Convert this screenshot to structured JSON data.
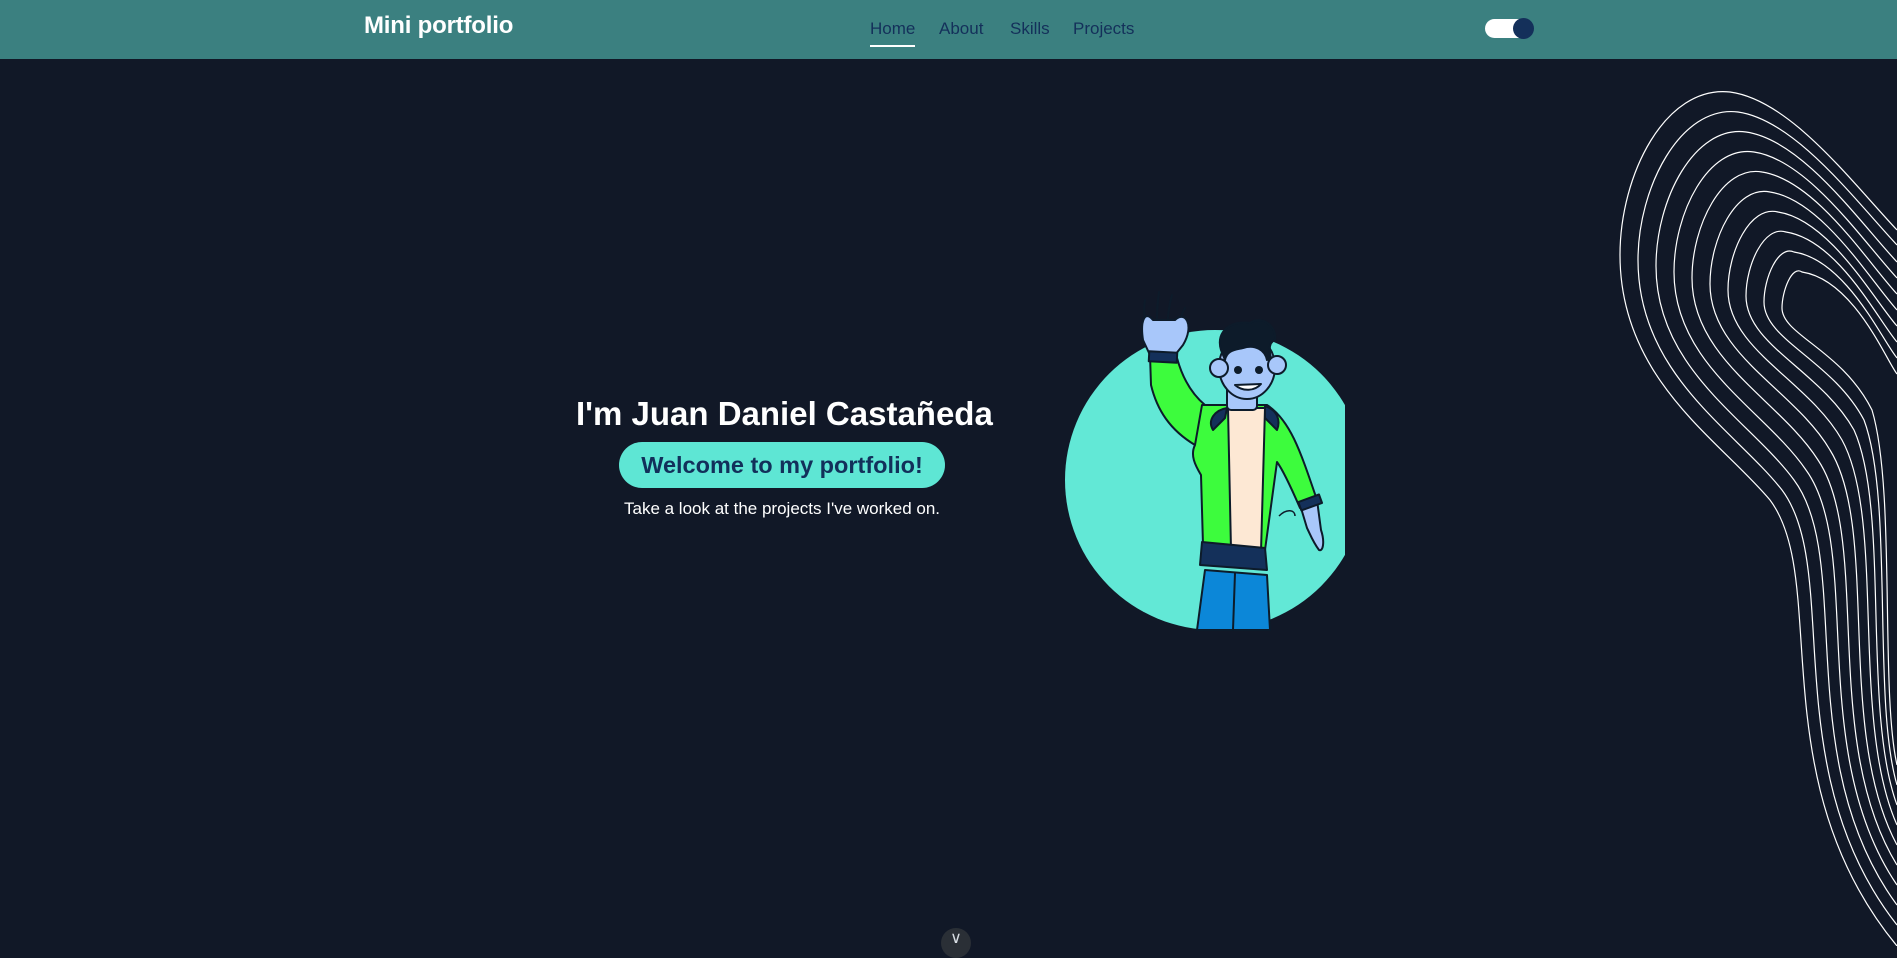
{
  "header": {
    "logo": "Mini portfolio",
    "nav": [
      {
        "label": "Home",
        "active": true
      },
      {
        "label": "About",
        "active": false
      },
      {
        "label": "Skills",
        "active": false
      },
      {
        "label": "Projects",
        "active": false
      }
    ],
    "theme_toggle": {
      "state": "on"
    }
  },
  "hero": {
    "title": "I'm Juan Daniel Castañeda",
    "welcome": "Welcome to my portfolio!",
    "subtitle": "Take a look at the projects I've worked on."
  },
  "scroll_button": {
    "icon": "chevron-down-icon"
  },
  "colors": {
    "background": "#111827",
    "navbar": "#3b8080",
    "accent": "#5ee6d4",
    "nav_text": "#14305a"
  }
}
